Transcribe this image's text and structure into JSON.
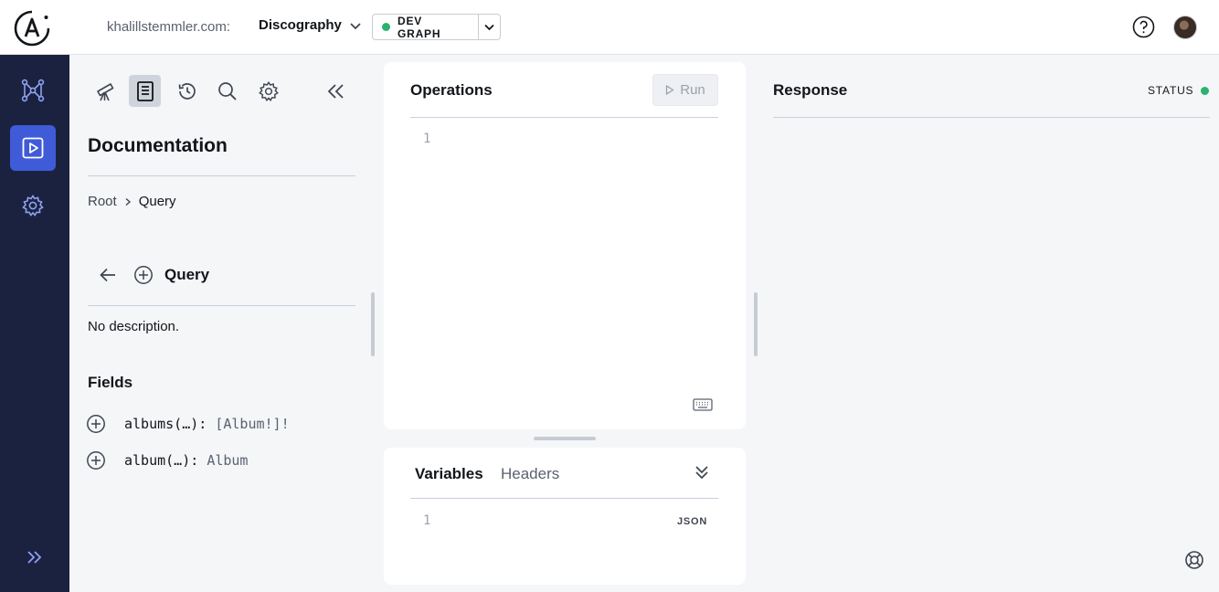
{
  "header": {
    "org": "khalillstemmler.com:",
    "graph": "Discography",
    "variant": "DEV GRAPH",
    "colors": {
      "status_ok": "#2ab26f",
      "accent": "#3f5bd8",
      "nav_bg": "#1b2240"
    }
  },
  "nav": {
    "items": [
      {
        "icon": "schema-graph-icon",
        "active": false
      },
      {
        "icon": "explorer-play-icon",
        "active": true
      },
      {
        "icon": "settings-icon",
        "active": false
      }
    ],
    "expand_icon": "double-chevron-right-icon"
  },
  "docs": {
    "title": "Documentation",
    "breadcrumb": [
      "Root",
      "Query"
    ],
    "type_name": "Query",
    "description": "No description.",
    "fields_title": "Fields",
    "fields": [
      {
        "name": "albums(…):",
        "type": "[Album!]!"
      },
      {
        "name": "album(…):",
        "type": "Album"
      }
    ]
  },
  "operations": {
    "title": "Operations",
    "run_label": "Run",
    "line_number": "1"
  },
  "variables": {
    "tabs": [
      "Variables",
      "Headers"
    ],
    "line_number": "1",
    "format": "JSON"
  },
  "response": {
    "title": "Response",
    "status_label": "STATUS"
  }
}
